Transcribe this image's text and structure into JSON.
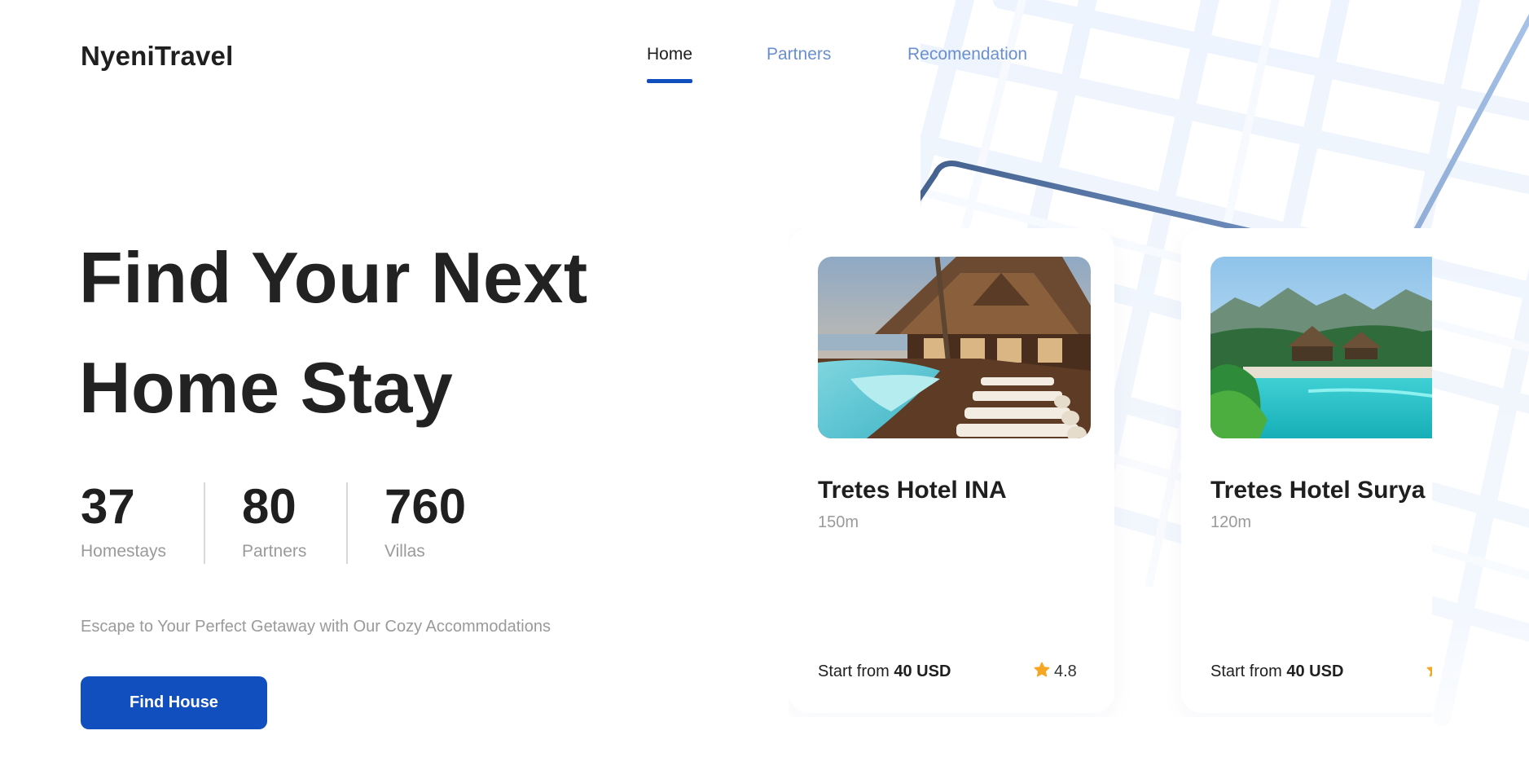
{
  "brand": {
    "name": "NyeniTravel"
  },
  "nav": {
    "items": [
      {
        "label": "Home",
        "active": true
      },
      {
        "label": "Partners",
        "active": false
      },
      {
        "label": "Recomendation",
        "active": false
      }
    ]
  },
  "hero": {
    "title_line1": "Find Your Next",
    "title_line2": "Home Stay",
    "stats": [
      {
        "value": "37",
        "label": "Homestays"
      },
      {
        "value": "80",
        "label": "Partners"
      },
      {
        "value": "760",
        "label": "Villas"
      }
    ],
    "tagline": "Escape to Your Perfect Getaway with Our Cozy Accommodations",
    "cta_label": "Find House"
  },
  "cards": [
    {
      "name": "Tretes Hotel INA",
      "distance": "150m",
      "price_prefix": "Start from",
      "price": "40 USD",
      "rating": "4.8",
      "image": "hotel-pool-deck-photo"
    },
    {
      "name": "Tretes Hotel Surya",
      "distance": "120m",
      "price_prefix": "Start from",
      "price": "40 USD",
      "rating": "",
      "image": "tropical-resort-pool-photo"
    }
  ],
  "colors": {
    "primary": "#124fbe",
    "nav_inactive": "#6a8fd0",
    "text_dark": "#1f1f1f",
    "text_muted": "#9a9a9a",
    "star": "#f5a623"
  },
  "icons": [
    "star-icon"
  ]
}
